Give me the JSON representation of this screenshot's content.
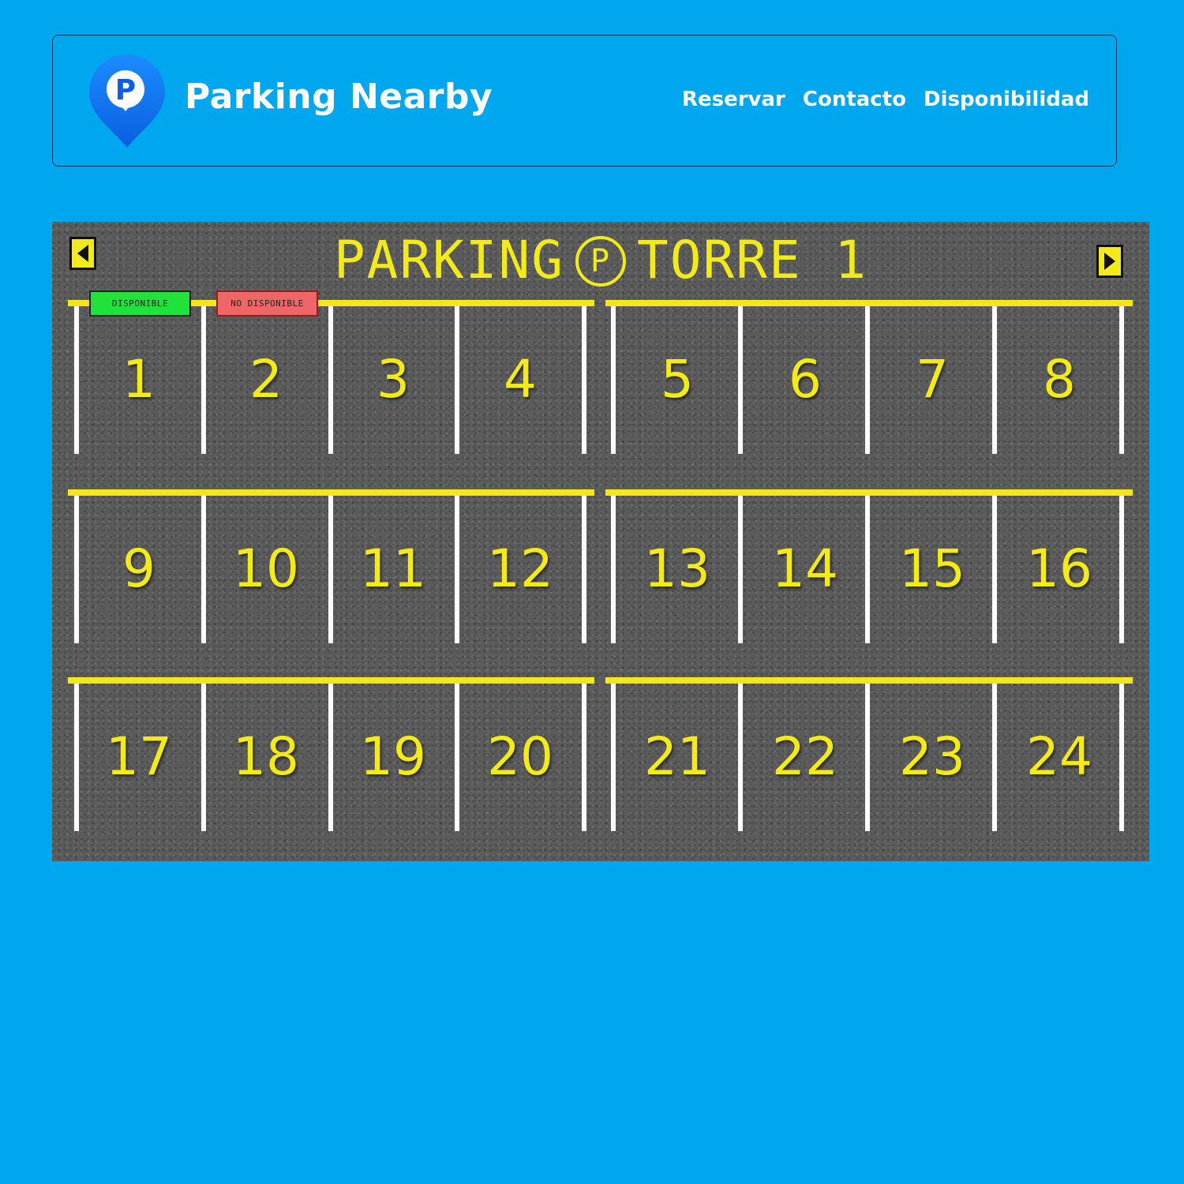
{
  "header": {
    "brand": "Parking Nearby",
    "logo_letter": "P",
    "nav": [
      {
        "label": "Reservar"
      },
      {
        "label": "Contacto"
      },
      {
        "label": "Disponibilidad"
      }
    ]
  },
  "lot": {
    "title_left": "PARKING",
    "title_symbol": "P",
    "title_right": "TORRE 1",
    "badges": {
      "available": "DISPONIBLE",
      "unavailable": "NO DISPONIBLE"
    },
    "spaces": [
      "1",
      "2",
      "3",
      "4",
      "5",
      "6",
      "7",
      "8",
      "9",
      "10",
      "11",
      "12",
      "13",
      "14",
      "15",
      "16",
      "17",
      "18",
      "19",
      "20",
      "21",
      "22",
      "23",
      "24"
    ]
  },
  "colors": {
    "background": "#00a6ee",
    "lot": "#5b5b5b",
    "paint_yellow": "#f4ea16",
    "available": "#20e23a",
    "unavailable": "#ef6666"
  }
}
